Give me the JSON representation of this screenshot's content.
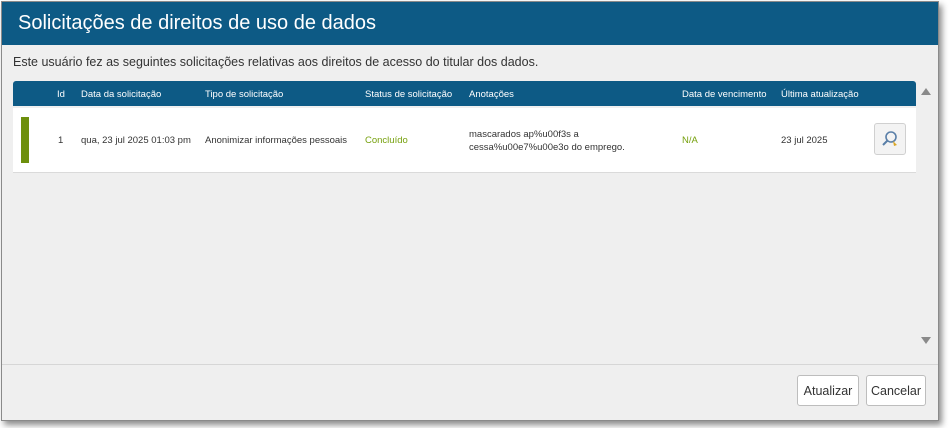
{
  "dialog": {
    "title": "Solicitações de direitos de uso de dados",
    "description": "Este usuário fez as seguintes solicitações relativas aos direitos de acesso do titular dos dados."
  },
  "table": {
    "columns": [
      "Id",
      "Data da solicitação",
      "Tipo de solicitação",
      "Status de solicitação",
      "Anotações",
      "Data de vencimento",
      "Última atualização"
    ],
    "rows": [
      {
        "id": "1",
        "request_date": "qua, 23 jul 2025 01:03 pm",
        "request_type": "Anonimizar informações pessoais",
        "status": "Concluído",
        "notes_line1": "mascarados ap%u00f3s a",
        "notes_line2": "cessa%u00e7%u00e3o do emprego.",
        "due_date": "N/A",
        "last_update": "23 jul 2025",
        "action_icon": "view-details-icon"
      }
    ]
  },
  "colors": {
    "header": "#0d5a85",
    "status_complete": "#76a00d",
    "status_bar": "#6d8f0c"
  },
  "footer": {
    "update_label": "Atualizar",
    "cancel_label": "Cancelar"
  }
}
